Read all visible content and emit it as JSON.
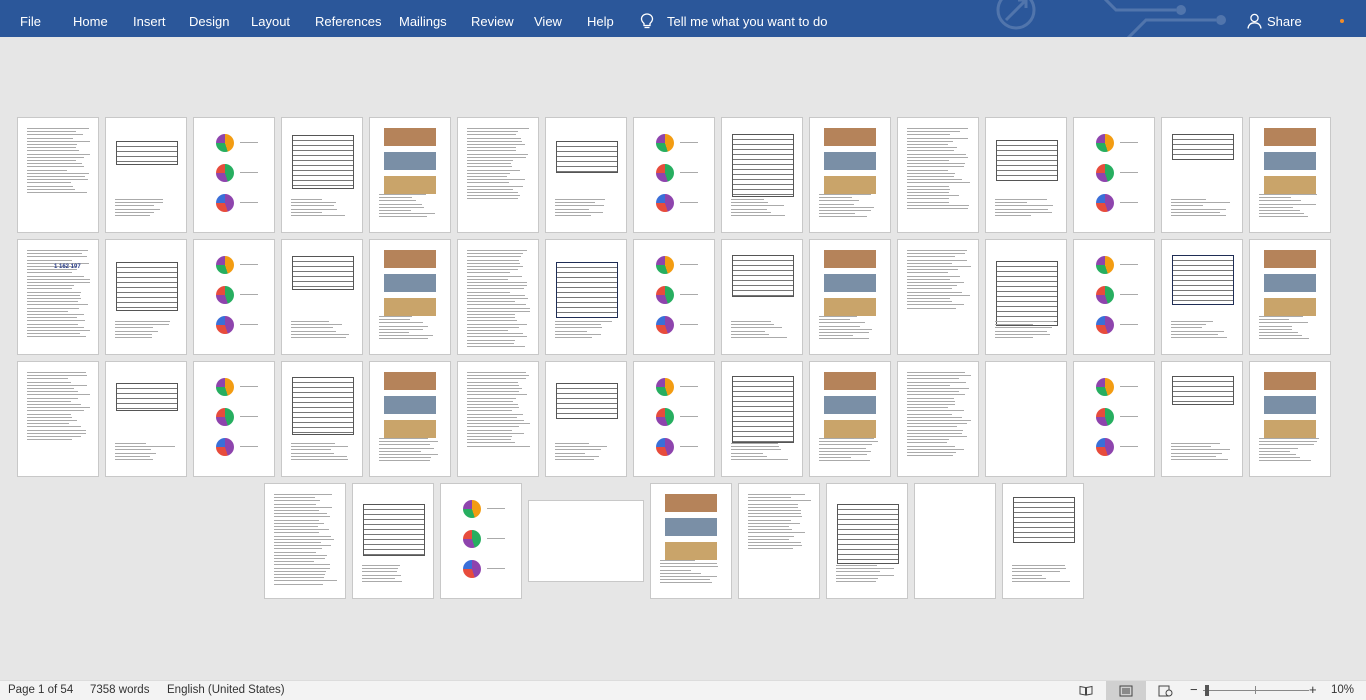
{
  "ribbon": {
    "tabs": [
      "File",
      "Home",
      "Insert",
      "Design",
      "Layout",
      "References",
      "Mailings",
      "Review",
      "View",
      "Help"
    ],
    "tell_me": "Tell me what you want to do",
    "share": "Share",
    "color": "#2b579a"
  },
  "document": {
    "page_count": 54
  },
  "status": {
    "page": "Page 1 of 54",
    "words": "7358 words",
    "language": "English (United States)",
    "zoom": "10%",
    "views": [
      "read-mode-icon",
      "print-layout-icon",
      "web-layout-icon"
    ]
  },
  "thumbnail_text": {
    "p4_number": "1 162 197"
  }
}
